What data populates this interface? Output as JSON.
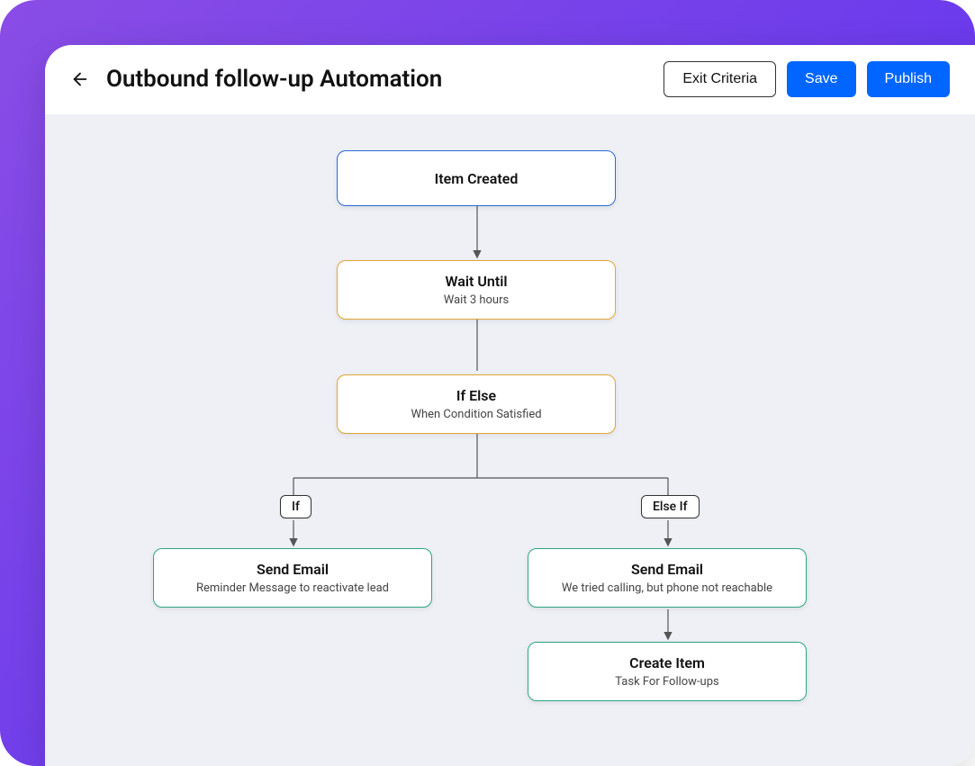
{
  "header": {
    "title": "Outbound follow-up Automation",
    "exit_criteria_label": "Exit Criteria",
    "save_label": "Save",
    "publish_label": "Publish"
  },
  "nodes": {
    "trigger": {
      "title": "Item Created"
    },
    "wait": {
      "title": "Wait Until",
      "subtitle": "Wait 3 hours"
    },
    "ifelse": {
      "title": "If Else",
      "subtitle": "When Condition Satisfied"
    },
    "branch_if_label": "If",
    "branch_elseif_label": "Else If",
    "email_if": {
      "title": "Send Email",
      "subtitle": "Reminder Message to reactivate lead"
    },
    "email_elseif": {
      "title": "Send Email",
      "subtitle": "We tried calling, but phone not reachable"
    },
    "create_item": {
      "title": "Create Item",
      "subtitle": "Task For Follow-ups"
    }
  },
  "colors": {
    "blue": "#2b6cd6",
    "orange": "#e3a43a",
    "green": "#2ea584",
    "primary": "#0066ff"
  }
}
